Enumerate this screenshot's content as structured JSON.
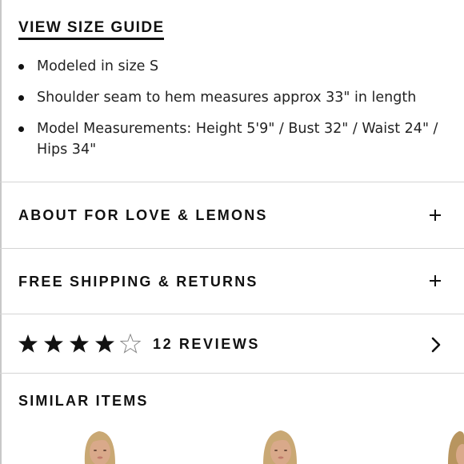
{
  "size_guide": {
    "label": "VIEW SIZE GUIDE"
  },
  "details": [
    "Modeled in size S",
    "Shoulder seam to hem measures approx 33\" in length",
    "Model Measurements: Height 5'9\" / Bust 32\" / Waist 24\" / Hips 34\""
  ],
  "accordion": {
    "about": {
      "label": "ABOUT FOR LOVE & LEMONS",
      "icon": "plus-icon"
    },
    "shipping": {
      "label": "FREE SHIPPING & RETURNS",
      "icon": "plus-icon"
    }
  },
  "reviews": {
    "rating": 4,
    "max_rating": 5,
    "label": "12 REVIEWS",
    "icon": "chevron-right-icon"
  },
  "similar": {
    "title": "SIMILAR ITEMS"
  },
  "colors": {
    "text": "#111111",
    "divider": "#d4d4d4",
    "skin": "#d9a98a",
    "hair": "#c9a874"
  }
}
